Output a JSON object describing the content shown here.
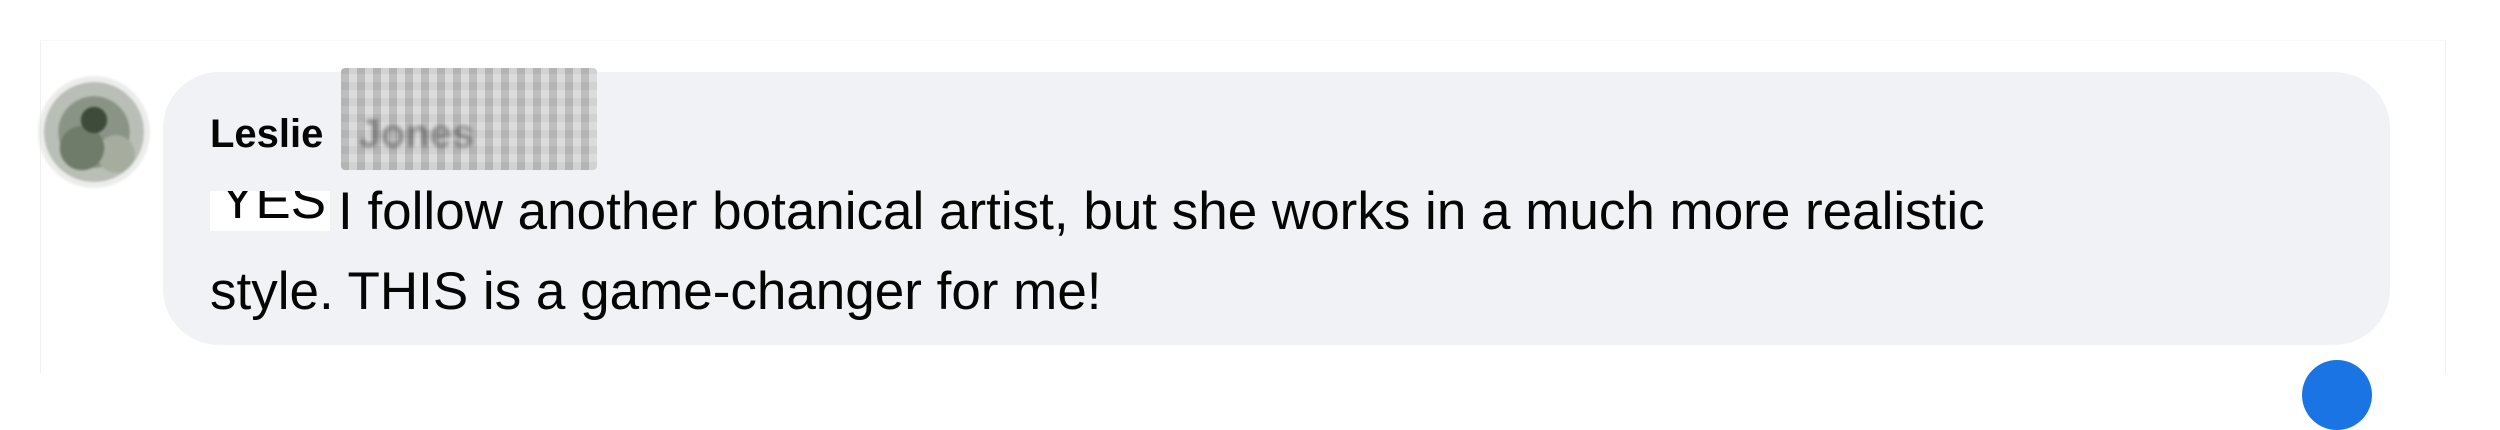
{
  "comment": {
    "author_first": "Leslie",
    "author_last_redacted": "Jones",
    "redacted_prefix": "YES!",
    "text_line1": "I follow another botanical artist, but she works in a much more realistic",
    "text_line2": "style. THIS is a game-changer for me!"
  },
  "colors": {
    "bubble_bg": "#f0f2f5",
    "text": "#050505",
    "reaction_blue": "#1b74e4"
  },
  "icons": {
    "reaction": "like-reaction-icon"
  }
}
